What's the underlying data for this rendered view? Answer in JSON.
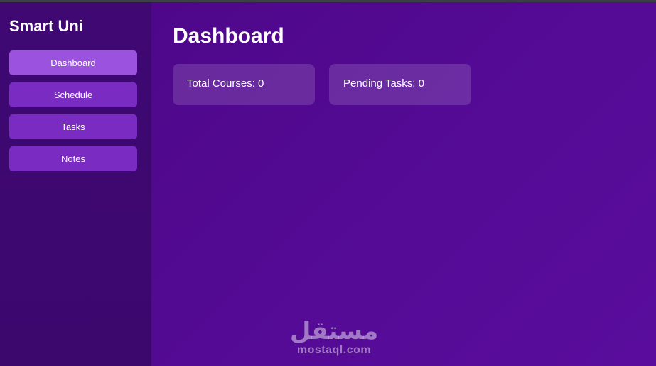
{
  "sidebar": {
    "brand": "Smart Uni",
    "items": [
      {
        "label": "Dashboard",
        "active": true
      },
      {
        "label": "Schedule",
        "active": false
      },
      {
        "label": "Tasks",
        "active": false
      },
      {
        "label": "Notes",
        "active": false
      }
    ]
  },
  "main": {
    "title": "Dashboard",
    "cards": [
      {
        "label": "Total Courses: 0"
      },
      {
        "label": "Pending Tasks: 0"
      }
    ]
  },
  "watermark": {
    "arabic": "مستقل",
    "latin": "mostaql.com"
  },
  "colors": {
    "sidebar_bg": "#3f0873",
    "main_bg": "#550b96",
    "nav_item": "#7a2bc2",
    "nav_item_active": "#9a52df"
  }
}
